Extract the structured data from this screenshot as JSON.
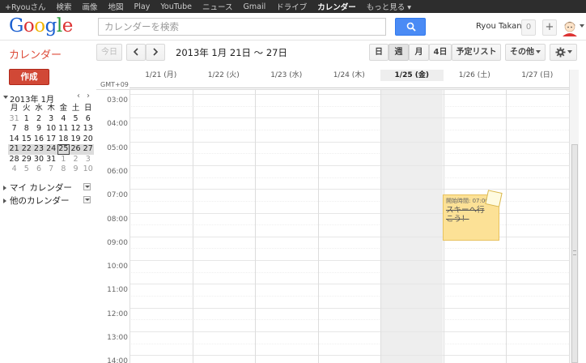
{
  "topbar": {
    "items": [
      "+Ryouさん",
      "検索",
      "画像",
      "地図",
      "Play",
      "YouTube",
      "ニュース",
      "Gmail",
      "ドライブ",
      "カレンダー",
      "もっと見る"
    ],
    "active_index": 9
  },
  "header": {
    "logo_letters": [
      "G",
      "o",
      "o",
      "g",
      "l",
      "e"
    ],
    "search_placeholder": "カレンダーを検索",
    "user_name": "Ryou Takano",
    "notification_count": "0",
    "share_label": "+"
  },
  "toolbar": {
    "app_title": "カレンダー",
    "today_label": "今日",
    "prev_label": "‹",
    "next_label": "›",
    "date_range": "2013年 1月 21日 ～ 27日",
    "views": {
      "day": "日",
      "week": "週",
      "month": "月",
      "four_day": "4日",
      "agenda": "予定リスト"
    },
    "active_view": "week",
    "more_label": "その他"
  },
  "sidebar": {
    "create_label": "作成",
    "mini_calendar": {
      "title": "2013年 1月",
      "weekdays": [
        "月",
        "火",
        "水",
        "木",
        "金",
        "土",
        "日"
      ],
      "weeks": [
        [
          "31",
          "1",
          "2",
          "3",
          "4",
          "5",
          "6"
        ],
        [
          "7",
          "8",
          "9",
          "10",
          "11",
          "12",
          "13"
        ],
        [
          "14",
          "15",
          "16",
          "17",
          "18",
          "19",
          "20"
        ],
        [
          "21",
          "22",
          "23",
          "24",
          "25",
          "26",
          "27"
        ],
        [
          "28",
          "29",
          "30",
          "31",
          "1",
          "2",
          "3"
        ],
        [
          "4",
          "5",
          "6",
          "7",
          "8",
          "9",
          "10"
        ]
      ],
      "highlight_week_index": 3,
      "today": {
        "week": 3,
        "day": 4
      }
    },
    "my_calendars_label": "マイ カレンダー",
    "other_calendars_label": "他のカレンダー"
  },
  "week_view": {
    "timezone": "GMT+09",
    "days": [
      "1/21 (月)",
      "1/22 (火)",
      "1/23 (水)",
      "1/24 (木)",
      "1/25 (金)",
      "1/26 (土)",
      "1/27 (日)"
    ],
    "today_index": 4,
    "hours": [
      "03:00",
      "04:00",
      "05:00",
      "06:00",
      "07:00",
      "08:00",
      "09:00",
      "10:00",
      "11:00",
      "12:00",
      "13:00",
      "14:00"
    ],
    "event": {
      "time": "開始時間: 07:00",
      "title": "スキーへ行こう！",
      "day": "1/26 (土)",
      "color": "#fce196"
    }
  },
  "colors": {
    "accent": "#dd4b39",
    "create_button": "#d14836",
    "search_button": "#4a8bf5"
  }
}
